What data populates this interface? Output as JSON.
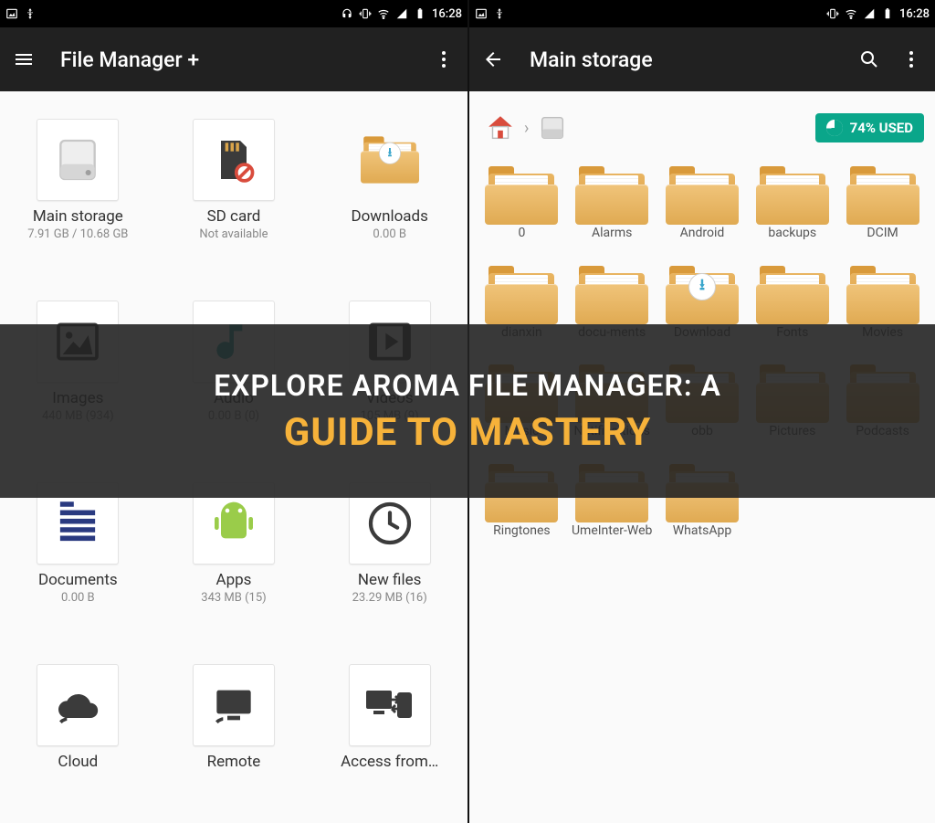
{
  "status_bar": {
    "time": "16:28",
    "left_icons": [
      "image-icon",
      "usb-icon"
    ],
    "right_icons": [
      "headset-icon",
      "vibrate-icon",
      "wifi-icon",
      "signal-icon",
      "battery-icon"
    ]
  },
  "left": {
    "toolbar": {
      "title": "File Manager +"
    },
    "categories": [
      {
        "id": "main-storage",
        "label": "Main storage",
        "sub": "7.91 GB / 10.68 GB",
        "icon": "drive"
      },
      {
        "id": "sd-card",
        "label": "SD card",
        "sub": "Not available",
        "icon": "sd"
      },
      {
        "id": "downloads",
        "label": "Downloads",
        "sub": "0.00 B",
        "icon": "folder-dl"
      },
      {
        "id": "images",
        "label": "Images",
        "sub": "440 MB (934)",
        "icon": "image"
      },
      {
        "id": "audio",
        "label": "Audio",
        "sub": "0.00 B (0)",
        "icon": "audio"
      },
      {
        "id": "videos",
        "label": "Videos",
        "sub": "105 MB (9)",
        "icon": "video"
      },
      {
        "id": "documents",
        "label": "Documents",
        "sub": "0.00 B",
        "icon": "doc"
      },
      {
        "id": "apps",
        "label": "Apps",
        "sub": "343 MB (15)",
        "icon": "apps"
      },
      {
        "id": "new-files",
        "label": "New files",
        "sub": "23.29 MB (16)",
        "icon": "clock"
      },
      {
        "id": "cloud",
        "label": "Cloud",
        "sub": "",
        "icon": "cloud"
      },
      {
        "id": "remote",
        "label": "Remote",
        "sub": "",
        "icon": "remote"
      },
      {
        "id": "access",
        "label": "Access from…",
        "sub": "",
        "icon": "access"
      }
    ]
  },
  "right": {
    "toolbar": {
      "title": "Main storage"
    },
    "usage_label": "74% USED",
    "folders": [
      {
        "name": "0"
      },
      {
        "name": "Alarms"
      },
      {
        "name": "Android"
      },
      {
        "name": "backups"
      },
      {
        "name": "DCIM"
      },
      {
        "name": "dianxin"
      },
      {
        "name": "docu-ments"
      },
      {
        "name": "Download",
        "dl": true
      },
      {
        "name": "Fonts"
      },
      {
        "name": "Movies"
      },
      {
        "name": "Music"
      },
      {
        "name": "Notifica-tions"
      },
      {
        "name": "obb"
      },
      {
        "name": "Pictures"
      },
      {
        "name": "Podcasts"
      },
      {
        "name": "Ringtones"
      },
      {
        "name": "UmeInter-Web"
      },
      {
        "name": "WhatsApp"
      }
    ]
  },
  "overlay": {
    "line1": "Explore Aroma File Manager: A",
    "line2": "Guide to Mastery"
  }
}
